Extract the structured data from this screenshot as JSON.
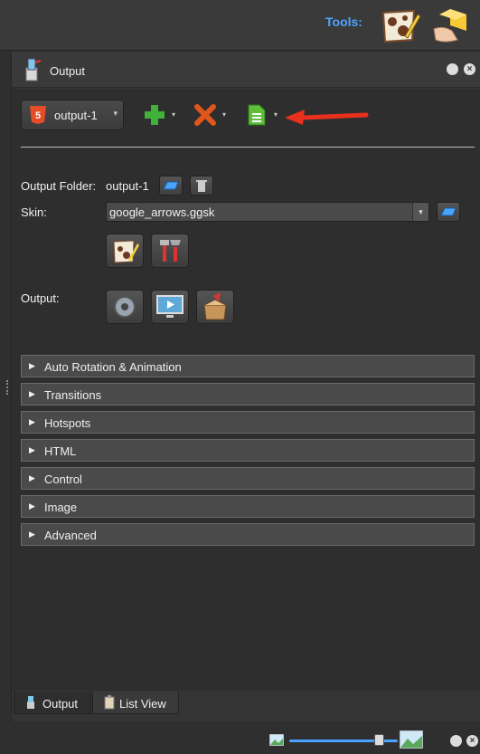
{
  "toolbar": {
    "tools_label": "Tools:",
    "tool_icons": [
      "panorama-editor-icon",
      "box-package-icon"
    ]
  },
  "panel": {
    "title": "Output",
    "close_label": "×"
  },
  "output_selector": {
    "value": "output-1",
    "caret": "▾"
  },
  "form": {
    "output_folder_label": "Output Folder:",
    "output_folder_value": "output-1",
    "skin_label": "Skin:",
    "skin_value": "google_arrows.ggsk",
    "output_label": "Output:"
  },
  "sections": [
    {
      "title": "Auto Rotation & Animation"
    },
    {
      "title": "Transitions"
    },
    {
      "title": "Hotspots"
    },
    {
      "title": "HTML"
    },
    {
      "title": "Control"
    },
    {
      "title": "Image"
    },
    {
      "title": "Advanced"
    }
  ],
  "tabs": [
    {
      "label": "Output",
      "active": true
    },
    {
      "label": "List View",
      "active": false
    }
  ],
  "zoom": {
    "level": 0.8
  },
  "colors": {
    "accent": "#4da3ff",
    "arrow": "#e8301c",
    "add": "#3fb23a",
    "remove": "#e0561b",
    "html5": "#e44d26"
  }
}
